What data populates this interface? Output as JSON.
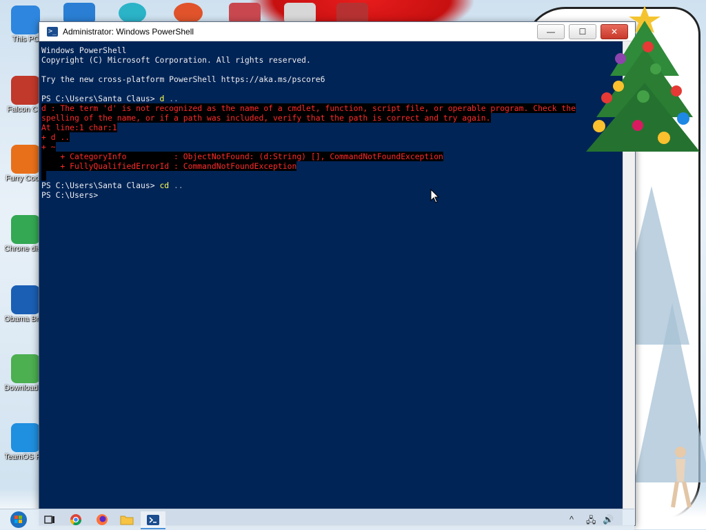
{
  "window": {
    "title": "Administrator: Windows PowerShell",
    "minimize_label": "—",
    "maximize_label": "☐",
    "close_label": "✕",
    "icon": "powershell-icon"
  },
  "console": {
    "lines": [
      {
        "type": "text",
        "text": "Windows PowerShell"
      },
      {
        "type": "text",
        "text": "Copyright (C) Microsoft Corporation. All rights reserved."
      },
      {
        "type": "text",
        "text": ""
      },
      {
        "type": "text",
        "text": "Try the new cross-platform PowerShell https://aka.ms/pscore6"
      },
      {
        "type": "text",
        "text": ""
      },
      {
        "type": "prompt",
        "prompt": "PS C:\\Users\\Santa Claus> ",
        "cmd": "d",
        "arg": " .."
      },
      {
        "type": "error",
        "text": "d : The term 'd' is not recognized as the name of a cmdlet, function, script file, or operable program. Check the"
      },
      {
        "type": "error",
        "text": "spelling of the name, or if a path was included, verify that the path is correct and try again."
      },
      {
        "type": "error",
        "text": "At line:1 char:1"
      },
      {
        "type": "error",
        "text": "+ d .."
      },
      {
        "type": "error",
        "text": "+ ~"
      },
      {
        "type": "error",
        "text": "    + CategoryInfo          : ObjectNotFound: (d:String) [], CommandNotFoundException"
      },
      {
        "type": "error",
        "text": "    + FullyQualifiedErrorId : CommandNotFoundException"
      },
      {
        "type": "error",
        "text": " "
      },
      {
        "type": "prompt",
        "prompt": "PS C:\\Users\\Santa Claus> ",
        "cmd": "cd",
        "arg": " .."
      },
      {
        "type": "text",
        "text": "PS C:\\Users> "
      }
    ]
  },
  "desktop_icons": [
    {
      "label": "This PC",
      "icon": "monitor-icon",
      "color": "#2e86de"
    },
    {
      "label": "Falcon C...",
      "icon": "falcon-icon",
      "color": "#c0392b"
    },
    {
      "label": "Furry Coo...",
      "icon": "firefox-icon",
      "color": "#e8701a"
    },
    {
      "label": "Chrone disease",
      "icon": "chrome-icon",
      "color": "#34a853"
    },
    {
      "label": "Obama Browse",
      "icon": "obama-logo-icon",
      "color": "#1a5fb4"
    },
    {
      "label": "Download From tear",
      "icon": "notebook-icon",
      "color": "#4caf50"
    },
    {
      "label": "TeamOS Facebo",
      "icon": "gear-icon",
      "color": "#1f8fe0"
    }
  ],
  "taskbar": {
    "items": [
      {
        "name": "start-button",
        "icon": "windows-logo-icon"
      },
      {
        "name": "task-view-button",
        "icon": "task-view-icon"
      },
      {
        "name": "chrome-taskbar-button",
        "icon": "chrome-icon"
      },
      {
        "name": "firefox-taskbar-button",
        "icon": "firefox-icon"
      },
      {
        "name": "file-explorer-taskbar-button",
        "icon": "folder-icon"
      },
      {
        "name": "powershell-taskbar-button",
        "icon": "powershell-icon"
      }
    ],
    "tray": {
      "chevron": "^",
      "network": "🖧",
      "volume": "🔊"
    }
  },
  "colors": {
    "console_bg": "#012456",
    "console_fg": "#eeedf0",
    "error_fg": "#ff2a2a",
    "cmd_fg": "#ffff50"
  }
}
